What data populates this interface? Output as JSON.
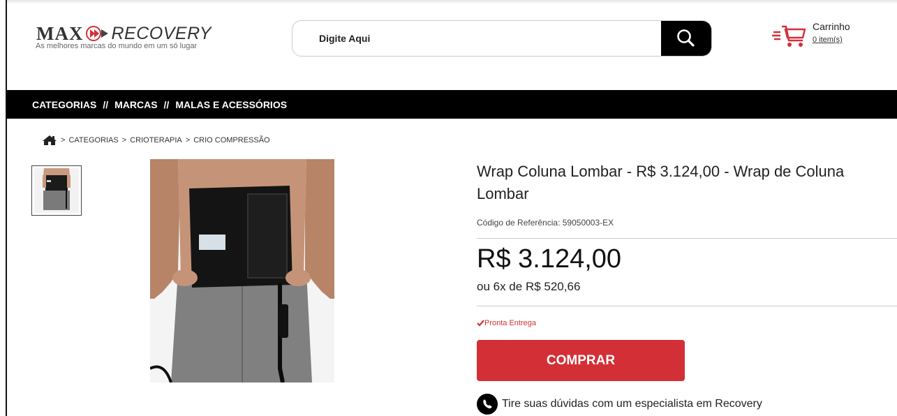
{
  "header": {
    "logo": {
      "brand_max": "MAX",
      "brand_recovery": "RECOVERY",
      "tagline": "As melhores marcas do mundo em um só lugar"
    },
    "search": {
      "placeholder": "Digite Aqui"
    },
    "cart": {
      "title": "Carrinho",
      "count": "0 item(s)"
    }
  },
  "nav": {
    "items": [
      "CATEGORIAS",
      "MARCAS",
      "MALAS E ACESSÓRIOS"
    ],
    "separator": "//"
  },
  "breadcrumb": {
    "separator": ">",
    "items": [
      "CATEGORIAS",
      "CRIOTERAPIA",
      "CRIO COMPRESSÃO"
    ]
  },
  "product": {
    "title": "Wrap Coluna Lombar - R$ 3.124,00 - Wrap de Coluna Lombar",
    "reference": "Código de Referência: 59050003-EX",
    "price": "R$ 3.124,00",
    "installments": "ou 6x de R$ 520,66",
    "stock": "Pronta Entrega",
    "buy_label": "COMPRAR",
    "help_text": "Tire suas dúvidas com um especialista em Recovery"
  },
  "colors": {
    "accent_red": "#d32f37",
    "nav_bg": "#000000",
    "stock_red": "#d32f2f"
  },
  "icons": {
    "search": "search-icon",
    "cart": "cart-icon",
    "home": "home-icon",
    "check": "check-icon",
    "whatsapp": "whatsapp-icon"
  }
}
